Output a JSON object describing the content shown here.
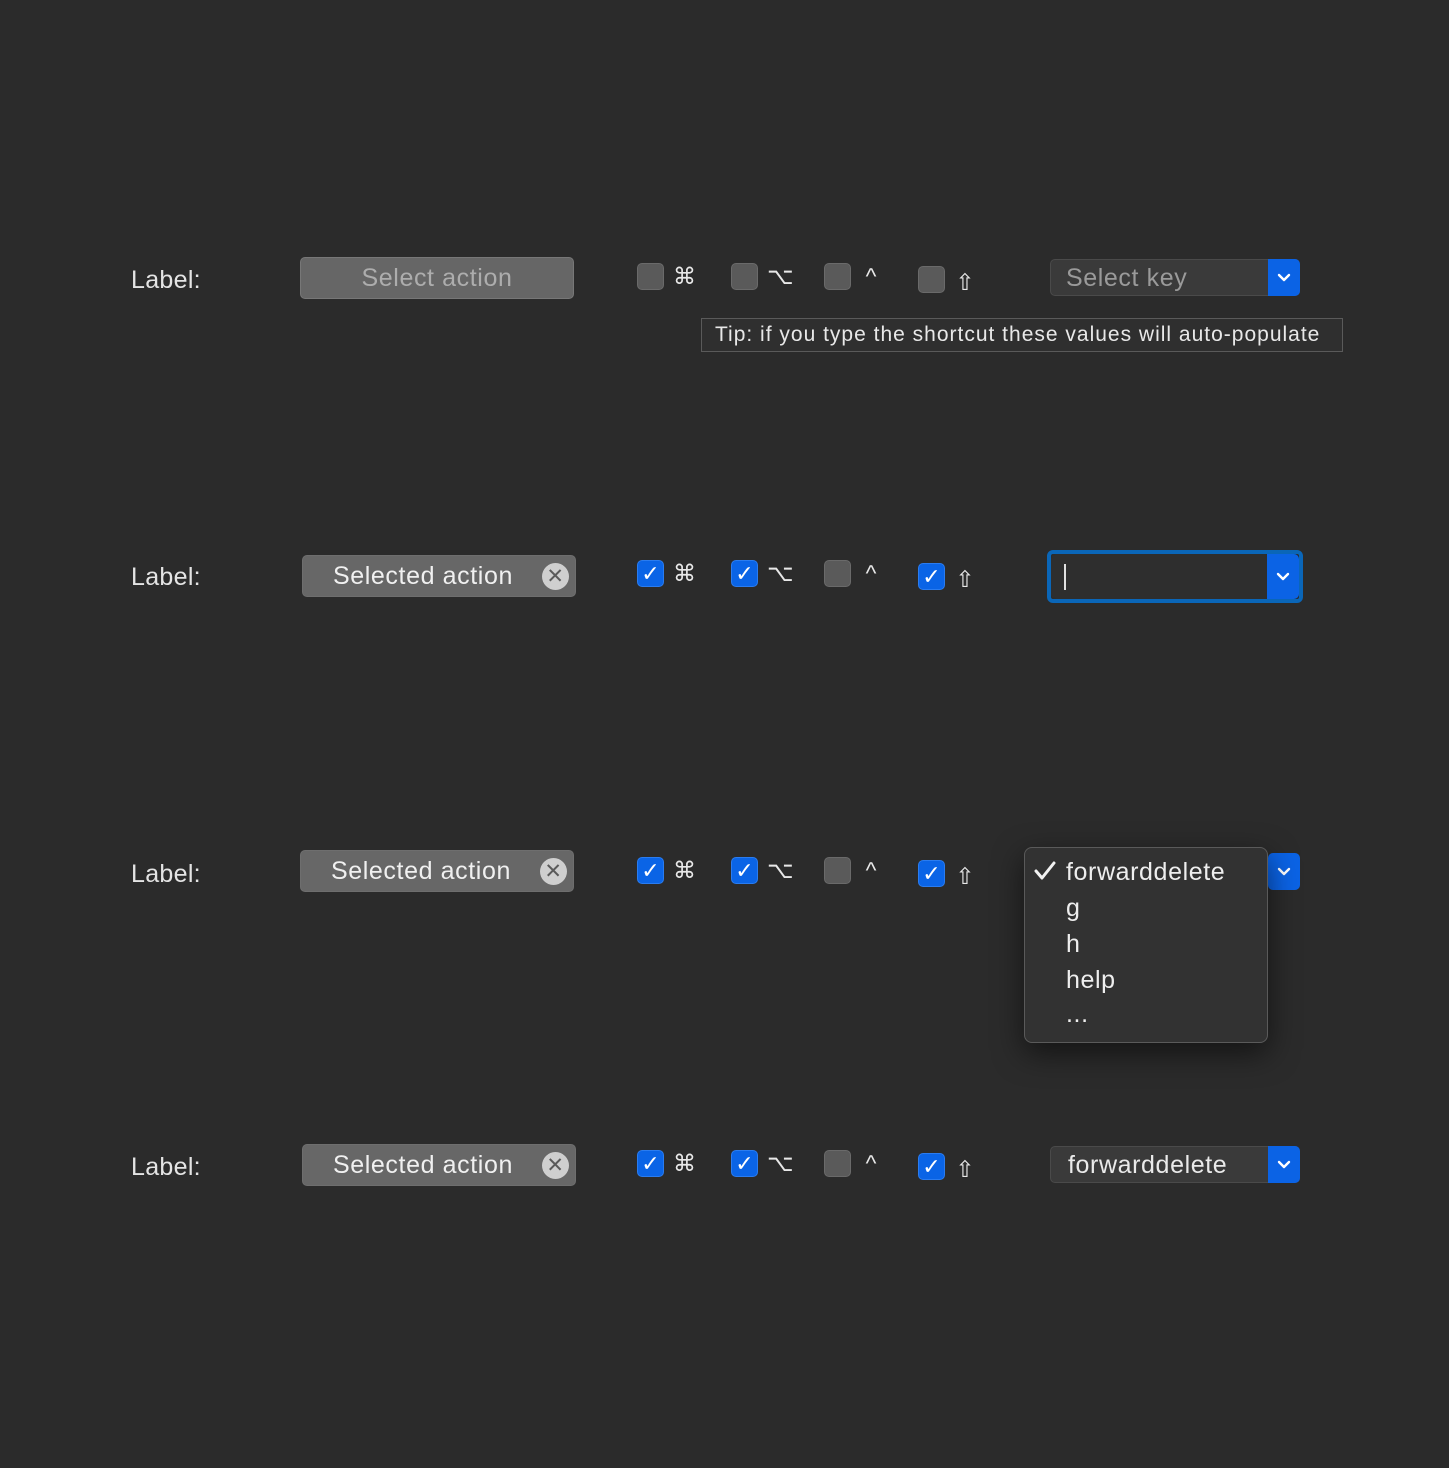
{
  "rows": [
    {
      "label": "Label:",
      "action": "Select action",
      "modifiers": [
        {
          "symbol": "⌘",
          "checked": false
        },
        {
          "symbol": "⌥",
          "checked": false
        },
        {
          "symbol": "^",
          "checked": false
        },
        {
          "symbol": "⇧",
          "checked": false
        }
      ],
      "key_placeholder": "Select key"
    },
    {
      "label": "Label:",
      "action": "Selected action",
      "modifiers": [
        {
          "symbol": "⌘",
          "checked": true
        },
        {
          "symbol": "⌥",
          "checked": true
        },
        {
          "symbol": "^",
          "checked": false
        },
        {
          "symbol": "⇧",
          "checked": true
        }
      ],
      "key_value": ""
    },
    {
      "label": "Label:",
      "action": "Selected action",
      "modifiers": [
        {
          "symbol": "⌘",
          "checked": true
        },
        {
          "symbol": "⌥",
          "checked": true
        },
        {
          "symbol": "^",
          "checked": false
        },
        {
          "symbol": "⇧",
          "checked": true
        }
      ]
    },
    {
      "label": "Label:",
      "action": "Selected action",
      "modifiers": [
        {
          "symbol": "⌘",
          "checked": true
        },
        {
          "symbol": "⌥",
          "checked": true
        },
        {
          "symbol": "^",
          "checked": false
        },
        {
          "symbol": "⇧",
          "checked": true
        }
      ],
      "key_value": "forwarddelete"
    }
  ],
  "tooltip": "Tip: if you type the shortcut these values will auto-populate",
  "dropdown_menu": {
    "selected": "forwarddelete",
    "items": [
      "forwarddelete",
      "g",
      "h",
      "help",
      "..."
    ]
  },
  "icons": {
    "clear": "clear-circle-icon",
    "chevron": "chevron-down-icon",
    "check": "checkmark-icon"
  },
  "colors": {
    "background": "#2b2b2b",
    "accent": "#0b63e5",
    "focus_ring": "#0a66b8"
  }
}
